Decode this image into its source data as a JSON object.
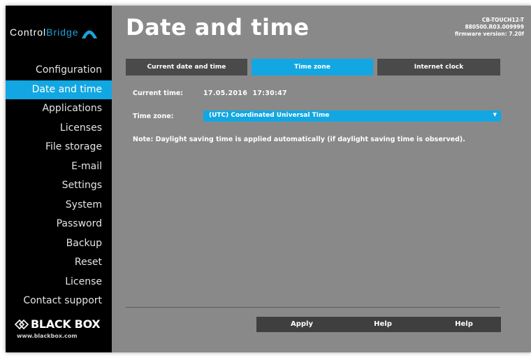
{
  "sidebar": {
    "logo": {
      "part1": "Control",
      "part2": "Bridge"
    },
    "items": [
      {
        "label": "Configuration"
      },
      {
        "label": "Date and time"
      },
      {
        "label": "Applications"
      },
      {
        "label": "Licenses"
      },
      {
        "label": "File storage"
      },
      {
        "label": "E-mail"
      },
      {
        "label": "Settings"
      },
      {
        "label": "System"
      },
      {
        "label": "Password"
      },
      {
        "label": "Backup"
      },
      {
        "label": "Reset"
      },
      {
        "label": "License"
      },
      {
        "label": "Contact support"
      }
    ],
    "active_index": 1,
    "brand": {
      "name": "BLACK BOX",
      "url": "www.blackbox.com"
    }
  },
  "header": {
    "title": "Date and time",
    "device": {
      "model": "CB-TOUCH12-T",
      "serial": "880500.R03.009999",
      "firmware": "firmware version: 7.20f"
    }
  },
  "tabs": [
    {
      "label": "Current date and time",
      "active": false
    },
    {
      "label": "Time zone",
      "active": true
    },
    {
      "label": "Internet clock",
      "active": false
    }
  ],
  "form": {
    "current_time_label": "Current time:",
    "current_time_value": "17.05.2016  17:30:47",
    "timezone_label": "Time zone:",
    "timezone_value": "(UTC) Coordinated Universal Time",
    "note": "Note: Daylight saving time is applied automatically (if daylight saving time is observed)."
  },
  "buttons": {
    "apply": "Apply",
    "help1": "Help",
    "help2": "Help"
  },
  "colors": {
    "accent": "#12a7e2",
    "background": "#898989",
    "sidebar": "#000000",
    "tab_inactive": "#4a4a4a",
    "button_bar": "#3f3f3f"
  },
  "icons": {
    "logo_mark": "bridge-arc-icon",
    "brand_mark": "black-box-diamond-icon",
    "select_arrow": "caret-down-icon"
  }
}
